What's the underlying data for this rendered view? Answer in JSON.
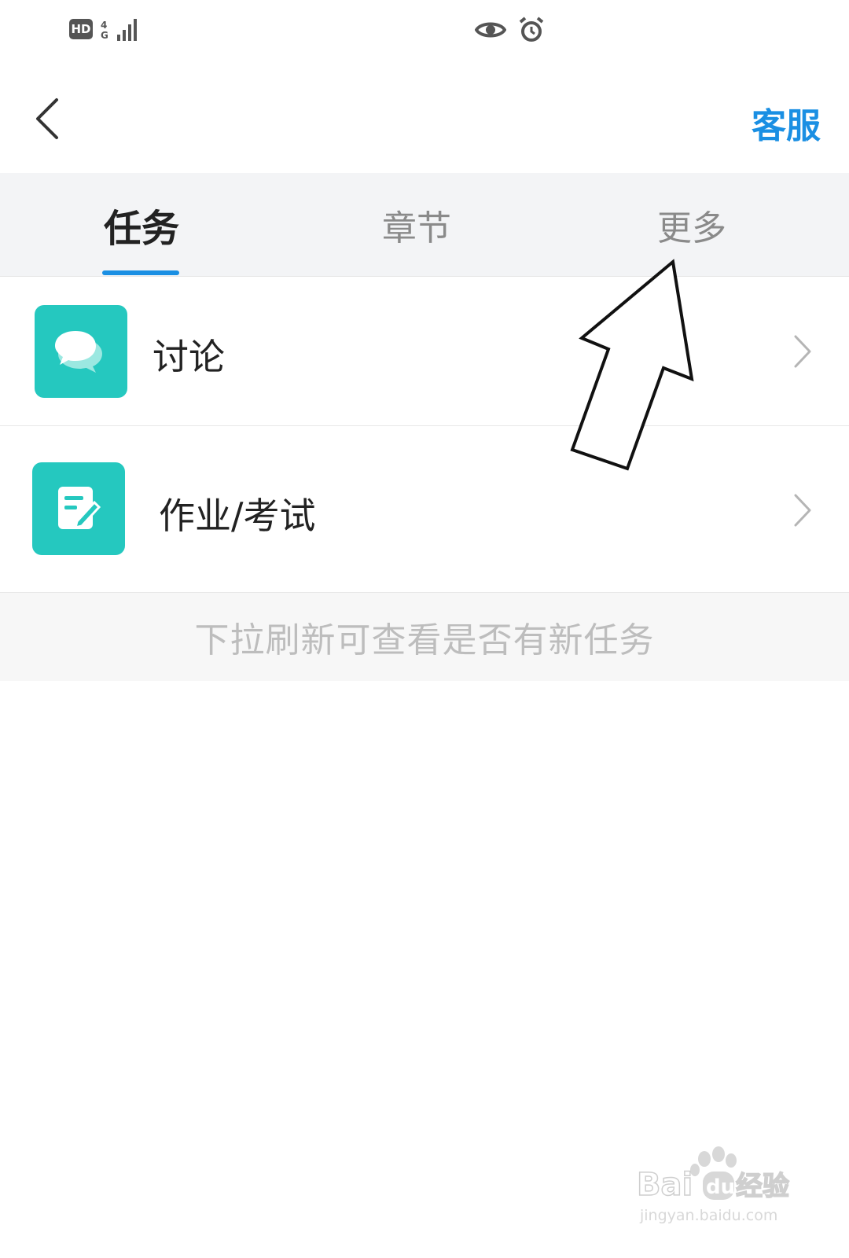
{
  "status_bar": {
    "hd": "HD",
    "network": "4G",
    "icons": [
      "eye-icon",
      "alarm-icon"
    ]
  },
  "header": {
    "back_icon": "chevron-left-icon",
    "service_label": "客服"
  },
  "tabs": [
    {
      "label": "任务",
      "active": true
    },
    {
      "label": "章节",
      "active": false
    },
    {
      "label": "更多",
      "active": false
    }
  ],
  "list": [
    {
      "label": "讨论",
      "icon": "chat-bubbles-icon"
    },
    {
      "label": "作业/考试",
      "icon": "edit-note-icon"
    }
  ],
  "hint": "下拉刷新可查看是否有新任务",
  "colors": {
    "accent": "#1a8fe3",
    "icon_bg": "#25c8bf",
    "tab_bg": "#f3f4f6"
  },
  "watermark": {
    "brand_left": "Bai",
    "brand_mid": "du",
    "brand_right": "经验",
    "url": "jingyan.baidu.com"
  }
}
